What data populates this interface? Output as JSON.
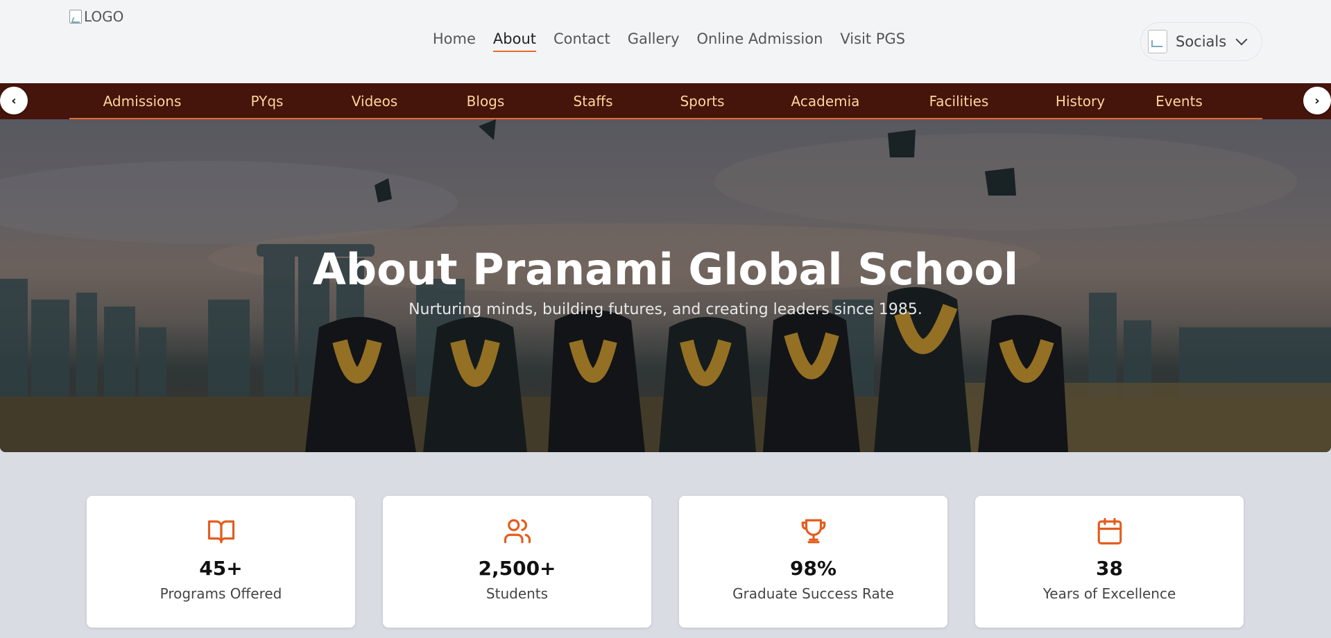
{
  "header": {
    "logo_alt": "LOGO",
    "nav": [
      {
        "label": "Home"
      },
      {
        "label": "About",
        "active": true
      },
      {
        "label": "Contact"
      },
      {
        "label": "Gallery"
      },
      {
        "label": "Online Admission"
      },
      {
        "label": "Visit PGS"
      }
    ],
    "socials_label": "Socials"
  },
  "subnav": {
    "items": [
      {
        "label": "Admissions"
      },
      {
        "label": "PYqs"
      },
      {
        "label": "Videos"
      },
      {
        "label": "Blogs"
      },
      {
        "label": "Staffs"
      },
      {
        "label": "Sports"
      },
      {
        "label": "Academia"
      },
      {
        "label": "Facilities"
      },
      {
        "label": "History"
      },
      {
        "label": "Events",
        "active": true
      }
    ],
    "prev_glyph": "‹",
    "next_glyph": "›"
  },
  "hero": {
    "title": "About Pranami Global School",
    "subtitle": "Nurturing minds, building futures, and creating leaders since 1985."
  },
  "stats": [
    {
      "icon": "book-icon",
      "value": "45+",
      "label": "Programs Offered"
    },
    {
      "icon": "users-icon",
      "value": "2,500+",
      "label": "Students"
    },
    {
      "icon": "trophy-icon",
      "value": "98%",
      "label": "Graduate Success Rate"
    },
    {
      "icon": "calendar-icon",
      "value": "38",
      "label": "Years of Excellence"
    }
  ],
  "colors": {
    "accent": "#e96a2c",
    "subnav_bg": "#45140b",
    "subnav_text": "#fbd79a",
    "page_bg": "#d9dde3"
  }
}
